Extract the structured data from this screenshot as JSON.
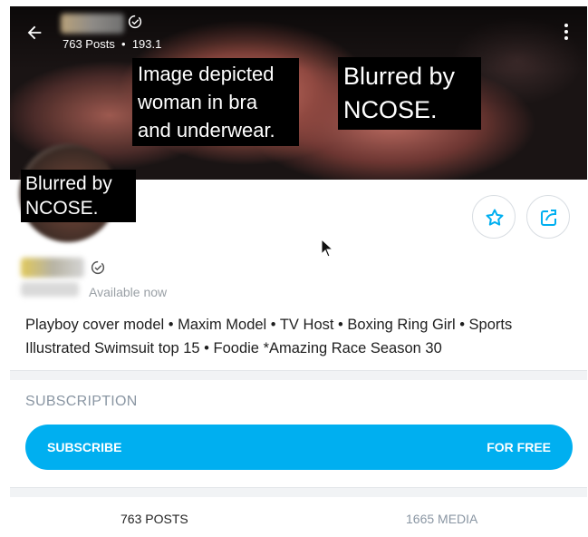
{
  "header": {
    "stats_text": "763 Posts  •  193.1"
  },
  "notes": {
    "cover_left": "Image depicted woman in bra and underwear.",
    "cover_right": "Blurred by NCOSE.",
    "avatar": "Blurred by NCOSE."
  },
  "profile": {
    "status": "Available now",
    "bio": "Playboy cover model • Maxim Model • TV Host • Boxing Ring Girl • Sports Illustrated Swimsuit top 15 • Foodie *Amazing Race Season 30"
  },
  "subscription": {
    "title": "SUBSCRIPTION",
    "button_left": "SUBSCRIBE",
    "button_right": "FOR FREE"
  },
  "tabs": {
    "posts": "763 POSTS",
    "media": "1665 MEDIA"
  },
  "colors": {
    "accent": "#00aff0",
    "muted": "#8a96a3"
  },
  "icons": [
    "back-arrow-icon",
    "verified-icon",
    "kebab-menu-icon",
    "star-icon",
    "share-icon",
    "cursor-icon"
  ]
}
